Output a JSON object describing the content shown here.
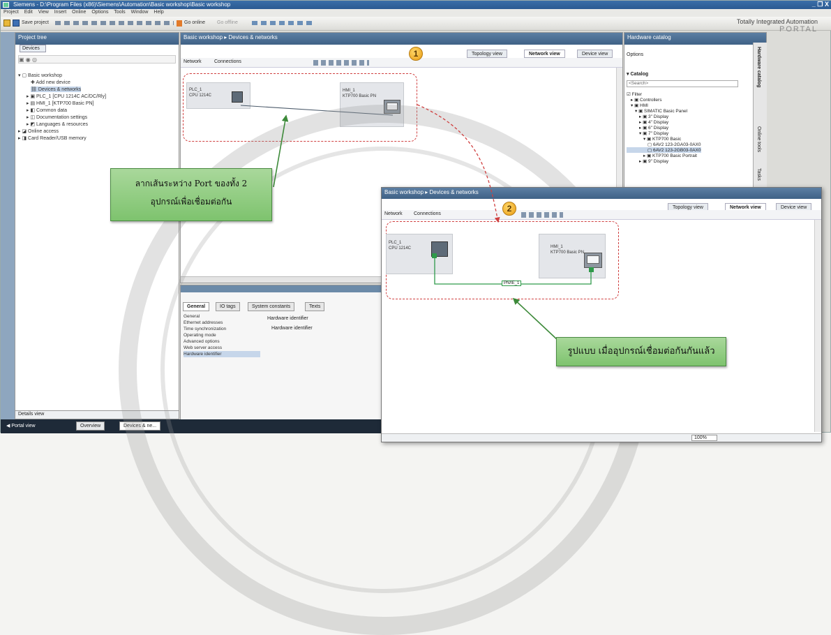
{
  "window": {
    "title": "Siemens - D:\\Program Files (x86)\\Siemens\\Automation\\Basic workshop\\Basic workshop",
    "controls": "_ ❐ X"
  },
  "menu": "Project  Edit  View  Insert  Online  Options  Tools  Window  Help",
  "toolbar": {
    "save_project": "Save project",
    "go_online": "Go online",
    "go_offline": "Go offline"
  },
  "branding": {
    "line1": "Totally Integrated Automation",
    "line2": "PORTAL"
  },
  "project_tree": {
    "header": "Project tree",
    "tab": "Devices",
    "items": [
      "Basic workshop",
      "Add new device",
      "Devices & networks",
      "PLC_1 [CPU 1214C AC/DC/Rly]",
      "HMI_1 [KTP700 Basic PN]",
      "Common data",
      "Documentation settings",
      "Languages & resources",
      "Online access",
      "Card Reader/USB memory"
    ],
    "details": "Details view"
  },
  "editor": {
    "breadcrumb": "Basic workshop ▸ Devices & networks",
    "tabs": [
      "Topology view",
      "Network view",
      "Device view"
    ],
    "network_btn": "Network",
    "connections_btn": "Connections",
    "plc": {
      "name": "PLC_1",
      "type": "CPU 1214C"
    },
    "hmi": {
      "name": "HMI_1",
      "type": "KTP700 Basic PN"
    }
  },
  "inspector": {
    "tabs": [
      "General",
      "IO tags",
      "System constants",
      "Texts"
    ],
    "items": [
      "General",
      "Ethernet addresses",
      "Time synchronization",
      "Operating mode",
      "Advanced options",
      "Web server access",
      "Hardware identifier"
    ],
    "fields": [
      "Hardware identifier",
      "Hardware identifier"
    ]
  },
  "catalog": {
    "header": "Hardware catalog",
    "options": "Options",
    "catalog_label": "Catalog",
    "search_placeholder": "<Search>",
    "filter": "Filter",
    "items": [
      "Controllers",
      "HMI",
      "SIMATIC Basic Panel",
      "3\" Display",
      "4\" Display",
      "6\" Display",
      "7\" Display",
      "KTP700 Basic",
      "6AV2 123-2GA03-0AX0",
      "6AV2 123-2GB03-0AX0",
      "KTP700 Basic Portrait",
      "9\" Display"
    ],
    "side_tabs": [
      "Hardware catalog",
      "Online tools",
      "Tasks"
    ]
  },
  "taskbar": {
    "portal": "Portal view",
    "overview": "Overview",
    "devices": "Devices & ne..."
  },
  "window2": {
    "breadcrumb": "Basic workshop ▸ Devices & networks",
    "tabs": [
      "Topology view",
      "Network view",
      "Device view"
    ],
    "network_btn": "Network",
    "connections_btn": "Connections",
    "plc": {
      "name": "PLC_1",
      "type": "CPU 1214C"
    },
    "hmi": {
      "name": "HMI_1",
      "type": "KTP700 Basic PN"
    },
    "subnet": "PN/IE_1",
    "zoom": "100%"
  },
  "annotations": {
    "badge1": "1",
    "badge2": "2",
    "callout1": "ลากเส้นระหว่าง Port ของทั้ง 2 อุปกรณ์เพื่อเชื่อมต่อกัน",
    "callout2": "รูปแบบ เมื่ออุปกรณ์เชื่อมต่อกันกันแล้ว"
  },
  "colors": {
    "annotation_dash": "#d04040",
    "callout_green": "#8fcc7e",
    "badge_orange": "#f0a820",
    "connection_green": "#2f9a4a"
  }
}
